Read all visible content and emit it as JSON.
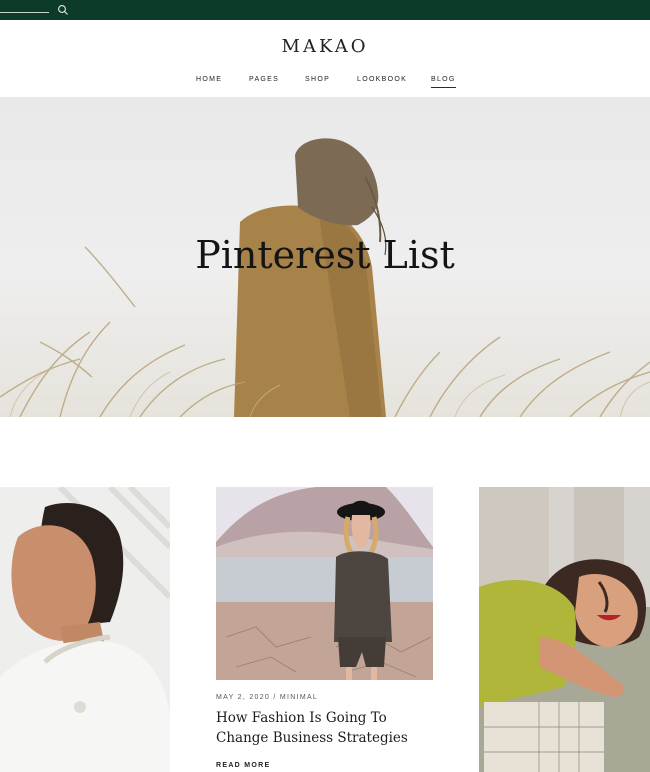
{
  "header": {
    "logo": "MAKAO",
    "nav": [
      "HOME",
      "PAGES",
      "SHOP",
      "LOOKBOOK",
      "BLOG"
    ],
    "active_nav": "BLOG"
  },
  "hero": {
    "title": "Pinterest List"
  },
  "featured_post": {
    "meta": "MAY 2, 2020 / MINIMAL",
    "title": "How Fashion Is Going To Change Business Strategies",
    "read_more": "READ MORE"
  },
  "colors": {
    "topbar": "#0d3b2a",
    "accent": "#0d3b2a"
  },
  "icons": {
    "search": "search-icon"
  }
}
